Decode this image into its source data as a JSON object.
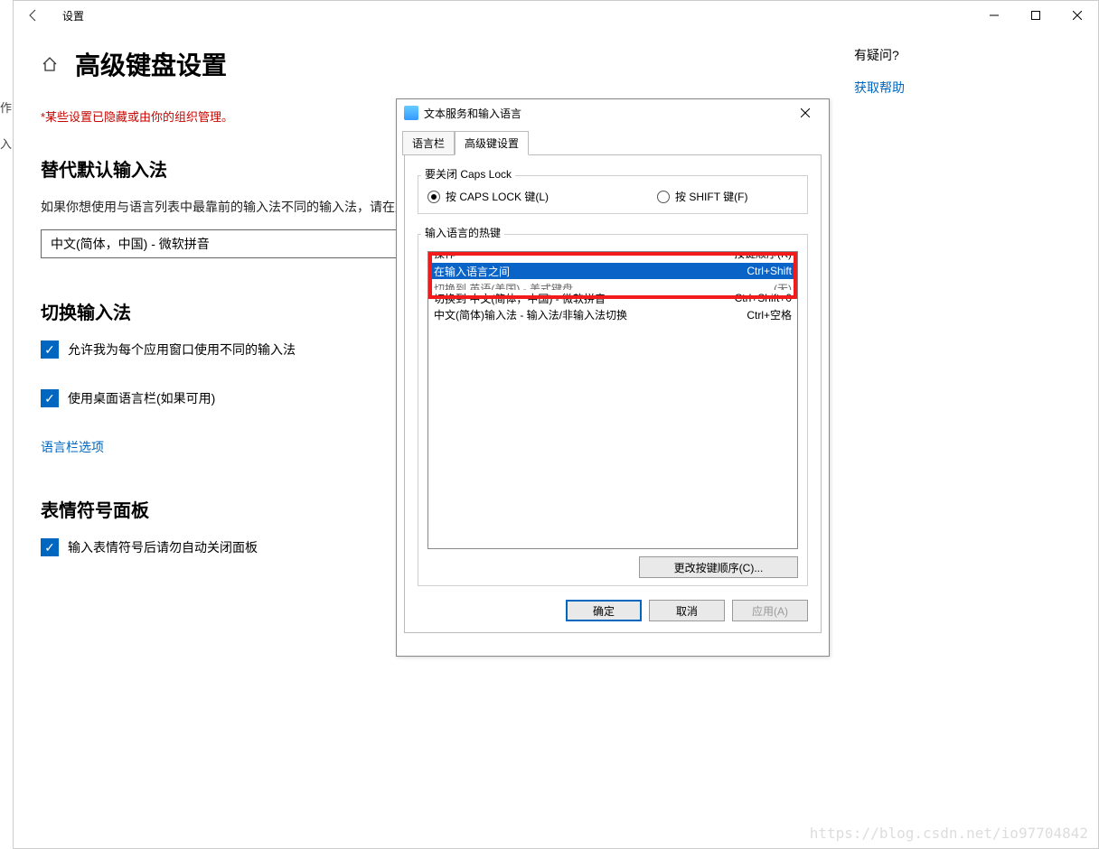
{
  "cutoff": "作\n入",
  "titlebar": {
    "title": "设置"
  },
  "heading": "高级键盘设置",
  "org_note": "*某些设置已隐藏或由你的组织管理。",
  "s_default": {
    "h": "替代默认输入法",
    "p": "如果你想使用与语言列表中最靠前的输入法不同的输入法，请在此处选择",
    "combo": "中文(简体，中国) - 微软拼音"
  },
  "s_switch": {
    "h": "切换输入法",
    "c1": "允许我为每个应用窗口使用不同的输入法",
    "c2": "使用桌面语言栏(如果可用)",
    "link": "语言栏选项"
  },
  "s_emoji": {
    "h": "表情符号面板",
    "c1": "输入表情符号后请勿自动关闭面板"
  },
  "side": {
    "q": "有疑问?",
    "help": "获取帮助"
  },
  "dialog": {
    "title": "文本服务和输入语言",
    "tabs": {
      "t1": "语言栏",
      "t2": "高级键设置"
    },
    "caps": {
      "legend": "要关闭 Caps Lock",
      "r1": "按 CAPS LOCK 键(L)",
      "r2": "按 SHIFT 键(F)"
    },
    "hotkeys": {
      "legend": "输入语言的热键",
      "header": {
        "l": "操作",
        "r": "按键顺序(K)"
      },
      "rows": [
        {
          "l": "在输入语言之间",
          "r": "Ctrl+Shift"
        },
        {
          "l": "切换到 英语(美国) - 美式键盘",
          "r": "(无)"
        },
        {
          "l": "切换到 中文(简体，中国) - 微软拼音",
          "r": "Ctrl+Shift+0"
        },
        {
          "l": "中文(简体)输入法 - 输入法/非输入法切换",
          "r": "Ctrl+空格"
        }
      ],
      "change": "更改按键顺序(C)..."
    },
    "btns": {
      "ok": "确定",
      "cancel": "取消",
      "apply": "应用(A)"
    }
  },
  "watermark": "https://blog.csdn.net/io97704842"
}
